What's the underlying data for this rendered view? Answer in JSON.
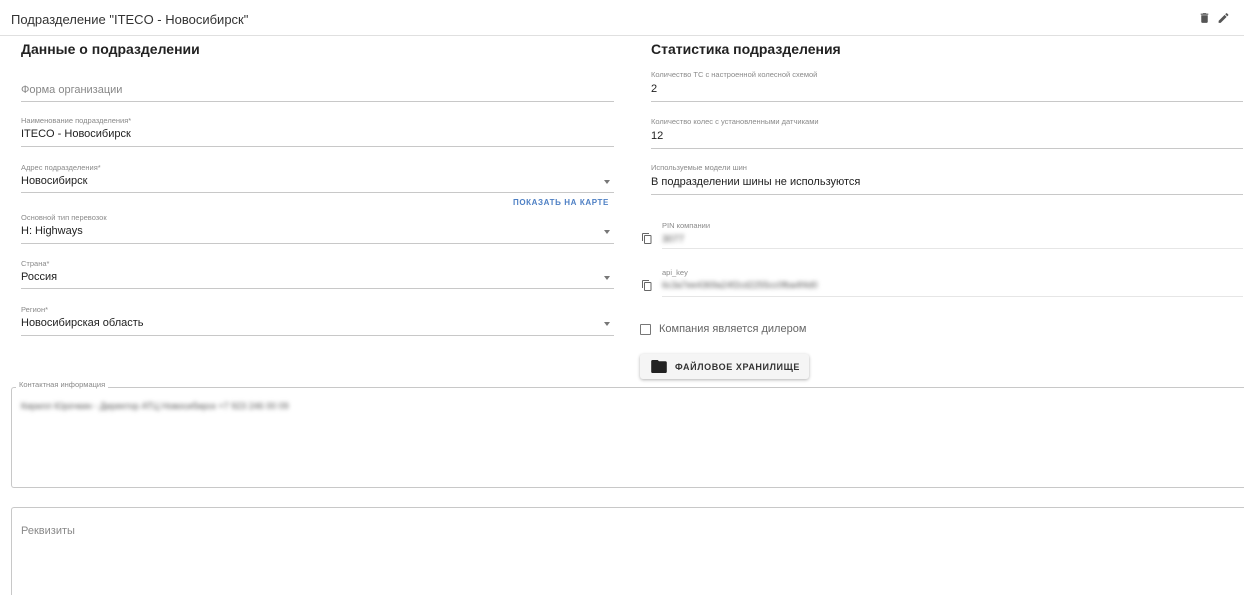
{
  "header": {
    "title": "Подразделение \"ITECO - Новосибирск\"",
    "icons": [
      "trash-icon",
      "pencil-icon"
    ]
  },
  "left": {
    "title": "Данные о подразделении",
    "org_form": {
      "placeholder": "Форма организации"
    },
    "name": {
      "label": "Наименование подразделения*",
      "value": "ITECO - Новосибирск"
    },
    "address": {
      "label": "Адрес подразделения*",
      "value": "Новосибирск"
    },
    "map_link": "ПОКАЗАТЬ НА КАРТЕ",
    "transport": {
      "label": "Основной тип перевозок",
      "value": "H: Highways"
    },
    "country": {
      "label": "Страна*",
      "value": "Россия"
    },
    "region": {
      "label": "Регион*",
      "value": "Новосибирская область"
    }
  },
  "right": {
    "title": "Статистика подразделения",
    "vehicles": {
      "label": "Количество ТС с настроенной колесной схемой",
      "value": "2"
    },
    "wheels": {
      "label": "Количество колес с установленными датчиками",
      "value": "12"
    },
    "tire_models": {
      "label": "Используемые модели шин",
      "value": "В подразделении шины не используются"
    },
    "pin": {
      "label": "PIN компании",
      "value": "3077"
    },
    "api_key": {
      "label": "api_key",
      "value": "6c3a7ee4369a24f2cd2255cc0fba4f4d0"
    },
    "dealer_checkbox": {
      "label": "Компания является дилером",
      "checked": false
    },
    "storage_button": "ФАЙЛОВОЕ ХРАНИЛИЩЕ"
  },
  "contact": {
    "label": "Контактная информация",
    "value": "Кирилл Юрочкин - Директор АТЦ Новосибирск +7 923 246 00 09"
  },
  "requisites": {
    "placeholder": "Реквизиты"
  }
}
